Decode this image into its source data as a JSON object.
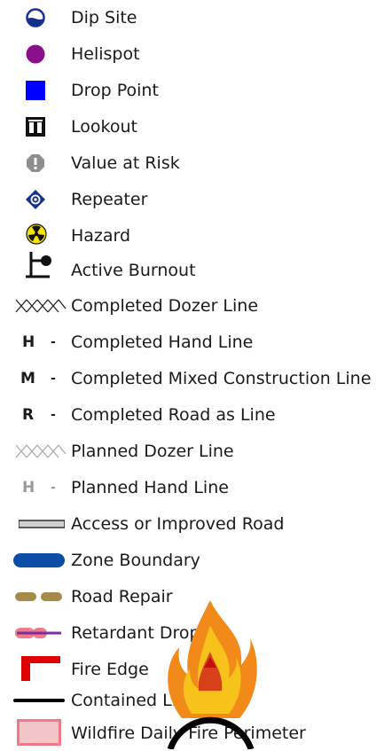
{
  "legend": {
    "items": [
      {
        "label": "Dip Site",
        "icon": "dip-site-icon"
      },
      {
        "label": "Helispot",
        "icon": "helispot-icon",
        "color": "#8a0f8a"
      },
      {
        "label": "Drop Point",
        "icon": "drop-point-icon",
        "color": "#0000ff"
      },
      {
        "label": "Lookout",
        "icon": "lookout-icon"
      },
      {
        "label": "Value at Risk",
        "icon": "value-at-risk-icon",
        "color": "#8e8e8e"
      },
      {
        "label": "Repeater",
        "icon": "repeater-icon",
        "color": "#15308f"
      },
      {
        "label": "Hazard",
        "icon": "hazard-icon",
        "color": "#f5e300"
      },
      {
        "label": "Active Burnout",
        "icon": "active-burnout-icon"
      },
      {
        "label": "Completed Dozer Line",
        "icon": "completed-dozer-line-icon"
      },
      {
        "label": "Completed Hand Line",
        "symbol_letter": "H",
        "symbol_dash": "-"
      },
      {
        "label": "Completed Mixed Construction Line",
        "symbol_letter": "M",
        "symbol_dash": "-"
      },
      {
        "label": "Completed Road as Line",
        "symbol_letter": "R",
        "symbol_dash": "-"
      },
      {
        "label": "Planned Dozer Line",
        "icon": "planned-dozer-line-icon"
      },
      {
        "label": "Planned Hand Line",
        "symbol_letter": "H",
        "symbol_dash": "-"
      },
      {
        "label": "Access or Improved Road",
        "icon": "road-icon"
      },
      {
        "label": "Zone Boundary",
        "icon": "zone-boundary-icon",
        "color": "#0a4ea6"
      },
      {
        "label": "Road Repair",
        "icon": "road-repair-icon",
        "color": "#a68a4c"
      },
      {
        "label": "Retardant Drop",
        "icon": "retardant-drop-icon",
        "color": "#f07a8a"
      },
      {
        "label": "Fire Edge",
        "icon": "fire-edge-icon",
        "color": "#e00000"
      },
      {
        "label": "Contained Line",
        "icon": "contained-line-icon",
        "color": "#000000"
      },
      {
        "label": "Wildfire Daily Fire Perimeter",
        "icon": "perimeter-icon",
        "color": "#f2c6c8"
      }
    ]
  }
}
